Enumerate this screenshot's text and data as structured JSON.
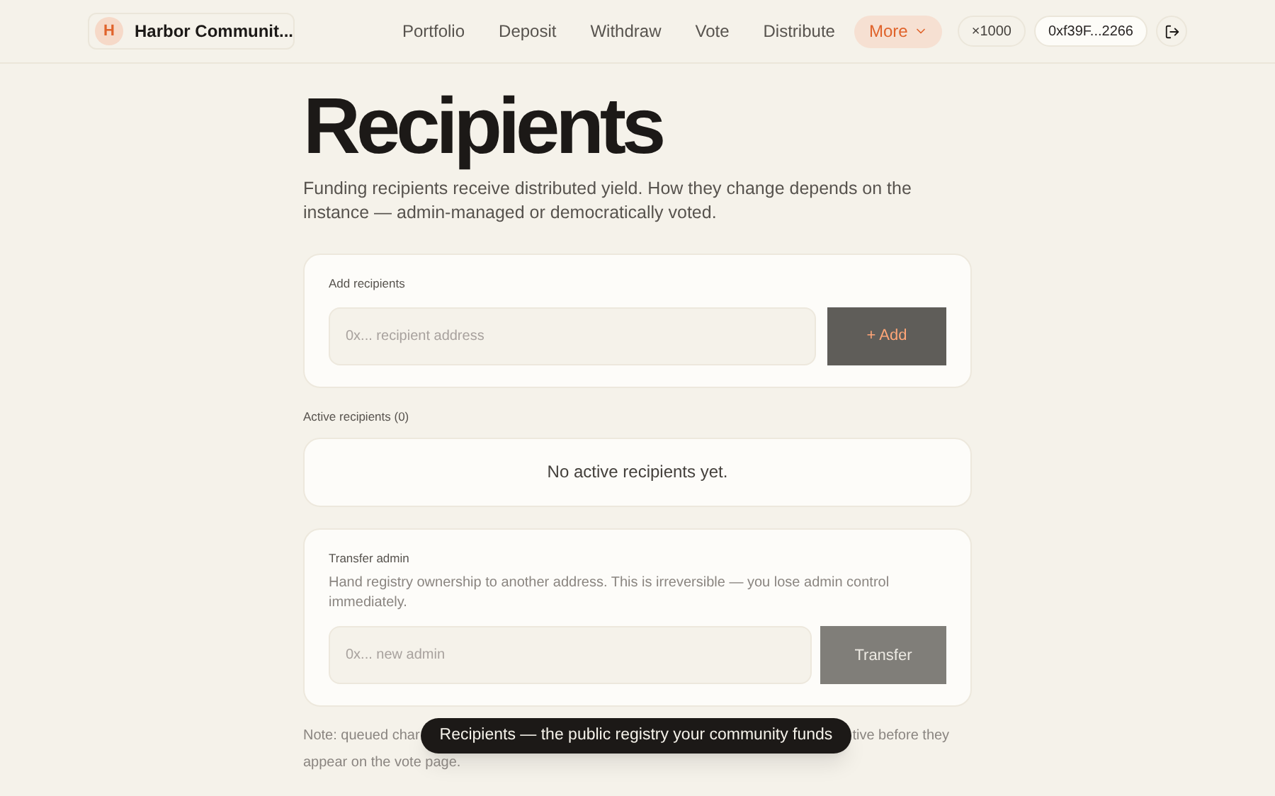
{
  "header": {
    "org_initial": "H",
    "org_name": "Harbor Communit...",
    "nav": [
      {
        "label": "Portfolio",
        "selected": false
      },
      {
        "label": "Deposit",
        "selected": false
      },
      {
        "label": "Withdraw",
        "selected": false
      },
      {
        "label": "Vote",
        "selected": false
      },
      {
        "label": "Distribute",
        "selected": false
      },
      {
        "label": "More",
        "selected": true
      }
    ],
    "multiplier": "×1000",
    "wallet": "0xf39F...2266"
  },
  "page": {
    "title": "Recipients",
    "subtitle": "Funding recipients receive distributed yield. How they change depends on the instance — admin-managed or democratically voted."
  },
  "add_card": {
    "label": "Add recipients",
    "placeholder": "0x... recipient address",
    "button": "+ Add",
    "disabled": true
  },
  "active": {
    "label": "Active recipients (0)",
    "empty": "No active recipients yet."
  },
  "transfer_card": {
    "label": "Transfer admin",
    "description": "Hand registry ownership to another address. This is irreversible — you lose admin control immediately.",
    "placeholder": "0x... new admin",
    "button": "Transfer",
    "disabled": true
  },
  "note": {
    "before": "Note: queued char",
    "after": "tive before they",
    "line2": "appear on the vote page."
  },
  "tooltip": "Recipients — the public registry your community funds"
}
